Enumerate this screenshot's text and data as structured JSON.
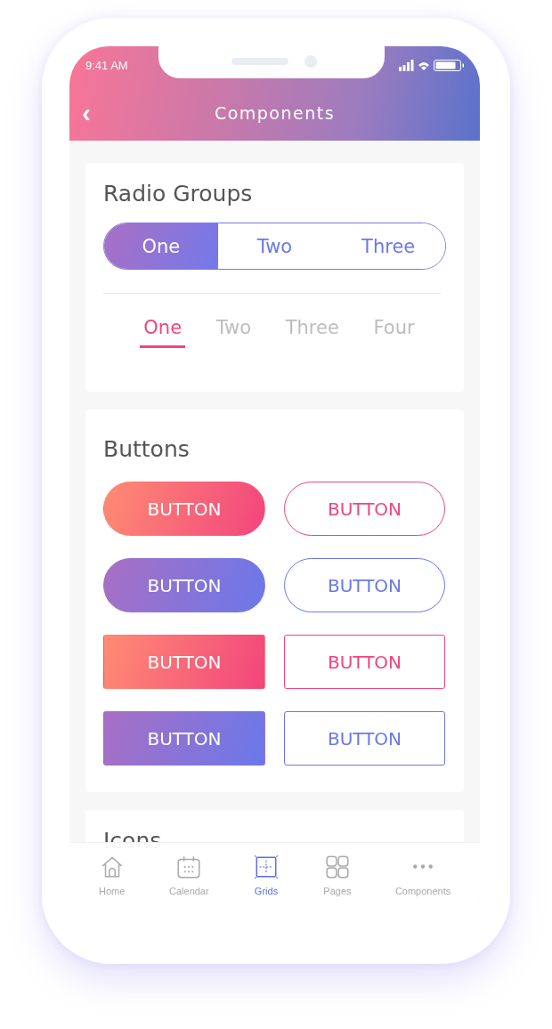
{
  "status_bar": {
    "time": "9:41 AM"
  },
  "header": {
    "back": "‹",
    "title": "Components"
  },
  "radio_groups": {
    "title": "Radio Groups",
    "segments": [
      {
        "label": "One",
        "selected": true
      },
      {
        "label": "Two",
        "selected": false
      },
      {
        "label": "Three",
        "selected": false
      }
    ],
    "tabs": [
      {
        "label": "One",
        "selected": true
      },
      {
        "label": "Two",
        "selected": false
      },
      {
        "label": "Three",
        "selected": false
      },
      {
        "label": "Four",
        "selected": false
      }
    ]
  },
  "buttons": {
    "title": "Buttons",
    "items": [
      {
        "label": "BUTTON",
        "kind": "solid-pill",
        "color": "#f2457d"
      },
      {
        "label": "BUTTON",
        "kind": "outline-pill",
        "color": "#f2457d"
      },
      {
        "label": "BUTTON",
        "kind": "solid-pill",
        "color": "#6a78ea"
      },
      {
        "label": "BUTTON",
        "kind": "outline-pill",
        "color": "#6a78ea"
      },
      {
        "label": "BUTTON",
        "kind": "solid-square",
        "color": "#f2457d"
      },
      {
        "label": "BUTTON",
        "kind": "outline-square",
        "color": "#f2457d"
      },
      {
        "label": "BUTTON",
        "kind": "solid-square",
        "color": "#6a78ea"
      },
      {
        "label": "BUTTON",
        "kind": "outline-square",
        "color": "#6a78ea"
      }
    ]
  },
  "icons": {
    "title": "Icons"
  },
  "tab_bar": [
    {
      "label": "Home",
      "kind": "home",
      "selected": false
    },
    {
      "label": "Calendar",
      "kind": "calendar",
      "selected": false
    },
    {
      "label": "Grids",
      "kind": "grid",
      "selected": true
    },
    {
      "label": "Pages",
      "kind": "pages",
      "selected": false
    },
    {
      "label": "Components",
      "kind": "more",
      "selected": false
    }
  ]
}
